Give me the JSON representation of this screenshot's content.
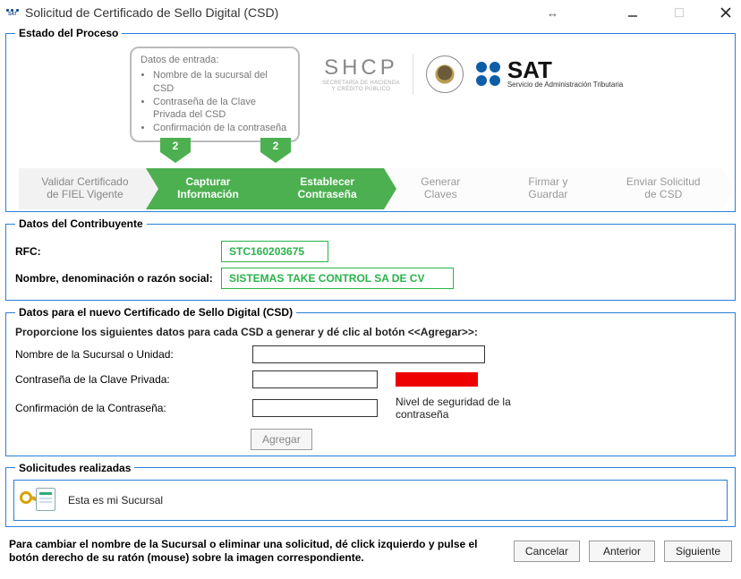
{
  "window": {
    "title": "Solicitud de Certificado de Sello Digital (CSD)"
  },
  "process": {
    "legend": "Estado del Proceso",
    "callout_title": "Datos de entrada:",
    "callout_items": [
      "Nombre de la sucursal del CSD",
      "Contraseña de la Clave Privada del CSD",
      "Confirmación de la contraseña"
    ],
    "shcp": {
      "title": "SHCP",
      "sub1": "SECRETARÍA DE HACIENDA",
      "sub2": "Y CRÉDITO PÚBLICO"
    },
    "sat": {
      "title": "SAT",
      "sub": "Servicio de Administración Tributaria"
    },
    "badge1": "2",
    "badge2": "2",
    "steps": {
      "s1": "Validar Certificado de FIEL Vigente",
      "s2": "Capturar Información",
      "s3": "Establecer Contraseña",
      "s4": "Generar Claves",
      "s5": "Firmar y Guardar",
      "s6": "Enviar Solicitud de CSD"
    }
  },
  "contrib": {
    "legend": "Datos del Contribuyente",
    "rfc_label": "RFC:",
    "rfc_value": "STC160203675",
    "name_label": "Nombre, denominación o razón social:",
    "name_value": "SISTEMAS TAKE CONTROL SA DE CV"
  },
  "csd": {
    "legend": "Datos para el nuevo Certificado de Sello Digital (CSD)",
    "instruction": "Proporcione los siguientes datos para cada CSD a generar y dé clic al botón <<Agregar>>:",
    "branch_label": "Nombre de la Sucursal o Unidad:",
    "branch_value": "",
    "pwd_label": "Contraseña de la Clave Privada:",
    "pwd_value": "",
    "confirm_label": "Confirmación de la Contraseña:",
    "confirm_value": "",
    "strength_caption": "Nivel de seguridad de la contraseña",
    "add_label": "Agregar"
  },
  "solicitudes": {
    "legend": "Solicitudes realizadas",
    "item": "Esta es mi Sucursal"
  },
  "footer": {
    "hint": "Para cambiar el nombre de la Sucursal o eliminar una solicitud, dé click izquierdo y pulse el botón derecho de su ratón (mouse) sobre la imagen correspondiente.",
    "cancel": "Cancelar",
    "prev": "Anterior",
    "next": "Siguiente"
  }
}
